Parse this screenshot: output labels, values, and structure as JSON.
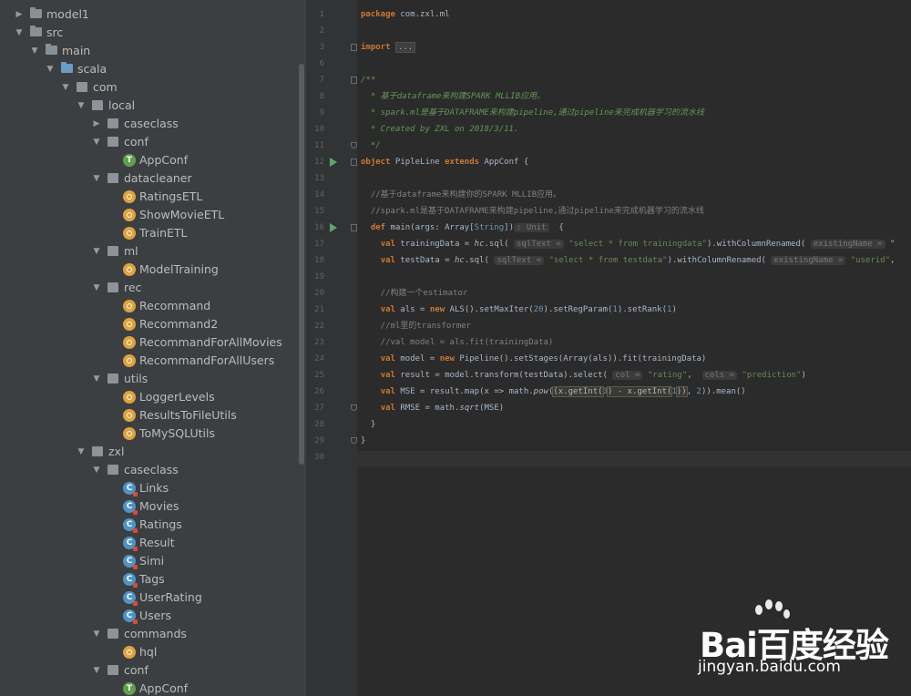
{
  "project_tree": {
    "items": [
      {
        "label": "model1",
        "depth": 0,
        "expanded": false,
        "icon": "folder-icon"
      },
      {
        "label": "src",
        "depth": 0,
        "expanded": true,
        "icon": "folder-icon"
      },
      {
        "label": "main",
        "depth": 1,
        "expanded": true,
        "icon": "folder-icon"
      },
      {
        "label": "scala",
        "depth": 2,
        "expanded": true,
        "icon": "source-folder-icon"
      },
      {
        "label": "com",
        "depth": 3,
        "expanded": true,
        "icon": "package-icon"
      },
      {
        "label": "local",
        "depth": 4,
        "expanded": true,
        "icon": "package-icon"
      },
      {
        "label": "caseclass",
        "depth": 5,
        "expanded": false,
        "icon": "package-icon"
      },
      {
        "label": "conf",
        "depth": 5,
        "expanded": true,
        "icon": "package-icon"
      },
      {
        "label": "AppConf",
        "depth": 6,
        "icon": "trait-icon"
      },
      {
        "label": "datacleaner",
        "depth": 5,
        "expanded": true,
        "icon": "package-icon"
      },
      {
        "label": "RatingsETL",
        "depth": 6,
        "icon": "object-icon"
      },
      {
        "label": "ShowMovieETL",
        "depth": 6,
        "icon": "object-icon"
      },
      {
        "label": "TrainETL",
        "depth": 6,
        "icon": "object-icon"
      },
      {
        "label": "ml",
        "depth": 5,
        "expanded": true,
        "icon": "package-icon"
      },
      {
        "label": "ModelTraining",
        "depth": 6,
        "icon": "object-icon"
      },
      {
        "label": "rec",
        "depth": 5,
        "expanded": true,
        "icon": "package-icon"
      },
      {
        "label": "Recommand",
        "depth": 6,
        "icon": "object-icon"
      },
      {
        "label": "Recommand2",
        "depth": 6,
        "icon": "object-icon"
      },
      {
        "label": "RecommandForAllMovies",
        "depth": 6,
        "icon": "object-icon"
      },
      {
        "label": "RecommandForAllUsers",
        "depth": 6,
        "icon": "object-icon"
      },
      {
        "label": "utils",
        "depth": 5,
        "expanded": true,
        "icon": "package-icon"
      },
      {
        "label": "LoggerLevels",
        "depth": 6,
        "icon": "object-icon"
      },
      {
        "label": "ResultsToFileUtils",
        "depth": 6,
        "icon": "object-icon"
      },
      {
        "label": "ToMySQLUtils",
        "depth": 6,
        "icon": "object-icon"
      },
      {
        "label": "zxl",
        "depth": 4,
        "expanded": true,
        "icon": "package-icon"
      },
      {
        "label": "caseclass",
        "depth": 5,
        "expanded": true,
        "icon": "package-icon"
      },
      {
        "label": "Links",
        "depth": 6,
        "icon": "case-class-icon"
      },
      {
        "label": "Movies",
        "depth": 6,
        "icon": "case-class-icon"
      },
      {
        "label": "Ratings",
        "depth": 6,
        "icon": "case-class-icon"
      },
      {
        "label": "Result",
        "depth": 6,
        "icon": "case-class-icon"
      },
      {
        "label": "Simi",
        "depth": 6,
        "icon": "case-class-icon"
      },
      {
        "label": "Tags",
        "depth": 6,
        "icon": "case-class-icon"
      },
      {
        "label": "UserRating",
        "depth": 6,
        "icon": "case-class-icon"
      },
      {
        "label": "Users",
        "depth": 6,
        "icon": "case-class-icon"
      },
      {
        "label": "commands",
        "depth": 5,
        "expanded": true,
        "icon": "package-icon"
      },
      {
        "label": "hql",
        "depth": 6,
        "icon": "object-icon"
      },
      {
        "label": "conf",
        "depth": 5,
        "expanded": true,
        "icon": "package-icon"
      },
      {
        "label": "AppConf",
        "depth": 6,
        "icon": "trait-icon"
      }
    ]
  },
  "editor": {
    "line_numbers": [
      "1",
      "2",
      "3",
      "6",
      "7",
      "8",
      "9",
      "10",
      "11",
      "12",
      "13",
      "14",
      "15",
      "16",
      "17",
      "18",
      "19",
      "20",
      "21",
      "22",
      "23",
      "24",
      "25",
      "26",
      "27",
      "28",
      "29",
      "30"
    ],
    "run_markers_on": [
      "12",
      "16"
    ],
    "lines": [
      [
        {
          "t": "package",
          "c": "kw"
        },
        {
          "t": " com.zxl.ml"
        }
      ],
      [],
      [
        {
          "t": "import",
          "c": "kw"
        },
        {
          "t": " "
        },
        {
          "t": "...",
          "c": "fold-hint"
        }
      ],
      [],
      [
        {
          "t": "/**",
          "c": "dkey"
        }
      ],
      [
        {
          "t": "  * 基于",
          "c": "dkey"
        },
        {
          "t": "dataframe",
          "c": "dkey"
        },
        {
          "t": "来构建SPARK MLLIB应用。",
          "c": "dkey"
        }
      ],
      [
        {
          "t": "  * spark.ml是基于DATAFRAME来构建pipeline,通过pipeline来完成机器学习的流水线",
          "c": "dkey"
        }
      ],
      [
        {
          "t": "  * Created by ZXL on 2018/3/11.",
          "c": "dkey"
        }
      ],
      [
        {
          "t": "  */",
          "c": "dkey"
        }
      ],
      [
        {
          "t": "object",
          "c": "kw"
        },
        {
          "t": " PipleLine "
        },
        {
          "t": "extends",
          "c": "kw"
        },
        {
          "t": " AppConf {"
        }
      ],
      [],
      [
        {
          "t": "  //基于dataframe来构建你的SPARK MLLIB应用。",
          "c": "cmt"
        }
      ],
      [
        {
          "t": "  //spark.ml是基于DATAFRAME来构建pipeline,通过pipeline来完成机器学习的流水线",
          "c": "cmt"
        }
      ],
      [
        {
          "t": "  "
        },
        {
          "t": "def",
          "c": "kw"
        },
        {
          "t": " main(args: Array["
        },
        {
          "t": "String",
          "c": "num"
        },
        {
          "t": "])"
        },
        {
          "t": ": Unit",
          "c": "hint"
        },
        {
          "t": "  {"
        }
      ],
      [
        {
          "t": "    "
        },
        {
          "t": "val",
          "c": "kw"
        },
        {
          "t": " trainingData = "
        },
        {
          "t": "hc",
          "c": "ital"
        },
        {
          "t": ".sql( "
        },
        {
          "t": "sqlText =",
          "c": "hint"
        },
        {
          "t": " "
        },
        {
          "t": "\"select * from trainingdata\"",
          "c": "str"
        },
        {
          "t": ").withColumnRenamed( "
        },
        {
          "t": "existingName =",
          "c": "hint"
        },
        {
          "t": " \""
        }
      ],
      [
        {
          "t": "    "
        },
        {
          "t": "val",
          "c": "kw"
        },
        {
          "t": " testData = "
        },
        {
          "t": "hc",
          "c": "ital"
        },
        {
          "t": ".sql( "
        },
        {
          "t": "sqlText =",
          "c": "hint"
        },
        {
          "t": " "
        },
        {
          "t": "\"select * from testdata\"",
          "c": "str"
        },
        {
          "t": ").withColumnRenamed( "
        },
        {
          "t": "existingName =",
          "c": "hint"
        },
        {
          "t": " "
        },
        {
          "t": "\"userid\"",
          "c": "str"
        },
        {
          "t": ","
        }
      ],
      [],
      [
        {
          "t": "    //构建一个estimator",
          "c": "cmt"
        }
      ],
      [
        {
          "t": "    "
        },
        {
          "t": "val",
          "c": "kw"
        },
        {
          "t": " als = "
        },
        {
          "t": "new",
          "c": "kw"
        },
        {
          "t": " ALS().setMaxIter("
        },
        {
          "t": "20",
          "c": "num"
        },
        {
          "t": ").setRegParam("
        },
        {
          "t": "1",
          "c": "num"
        },
        {
          "t": ").setRank("
        },
        {
          "t": "1",
          "c": "num"
        },
        {
          "t": ")"
        }
      ],
      [
        {
          "t": "    //ml里的transformer",
          "c": "cmt"
        }
      ],
      [
        {
          "t": "    //val model = als.fit(trainingData)",
          "c": "cmt"
        }
      ],
      [
        {
          "t": "    "
        },
        {
          "t": "val",
          "c": "kw"
        },
        {
          "t": " model = "
        },
        {
          "t": "new",
          "c": "kw"
        },
        {
          "t": " Pipeline().setStages(Array(als)).fit(trainingData)"
        }
      ],
      [
        {
          "t": "    "
        },
        {
          "t": "val",
          "c": "kw"
        },
        {
          "t": " result = model.transform(testData).select( "
        },
        {
          "t": "col =",
          "c": "hint"
        },
        {
          "t": " "
        },
        {
          "t": "\"rating\"",
          "c": "str"
        },
        {
          "t": ",  "
        },
        {
          "t": "cols =",
          "c": "hint"
        },
        {
          "t": " "
        },
        {
          "t": "\"prediction\"",
          "c": "str"
        },
        {
          "t": ")"
        }
      ],
      [
        {
          "t": "    "
        },
        {
          "t": "val",
          "c": "kw"
        },
        {
          "t": " MSE = result.map(x => math."
        },
        {
          "t": "pow",
          "c": "ital"
        },
        {
          "t": "("
        },
        {
          "t": "(x.getInt(",
          "c": "hl"
        },
        {
          "t": "0",
          "c": "num"
        },
        {
          "t": ") - x.getInt(",
          "c": "hl"
        },
        {
          "t": "1",
          "c": "num"
        },
        {
          "t": "))",
          "c": "hl"
        },
        {
          "t": ", "
        },
        {
          "t": "2",
          "c": "num"
        },
        {
          "t": ")).mean()"
        }
      ],
      [
        {
          "t": "    "
        },
        {
          "t": "val",
          "c": "kw"
        },
        {
          "t": " RMSE = math."
        },
        {
          "t": "sqrt",
          "c": "ital"
        },
        {
          "t": "(MSE)"
        }
      ],
      [
        {
          "t": "  }"
        }
      ],
      [
        {
          "t": "}"
        }
      ],
      []
    ]
  },
  "watermark": {
    "logo_text": "Bai百度经验",
    "url": "jingyan.baidu.com"
  }
}
